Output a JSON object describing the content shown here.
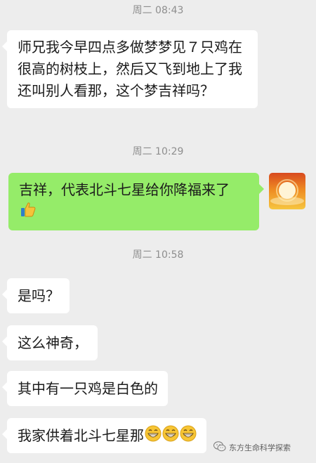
{
  "chat": {
    "messages": [
      {
        "type": "time",
        "text": "周二 08:43"
      },
      {
        "type": "incoming",
        "text": "师兄我今早四点多做梦梦见７只鸡在很高的树枝上，然后又飞到地上了我还叫别人看那，这个梦吉祥吗？"
      },
      {
        "type": "time",
        "text": "周二 10:29"
      },
      {
        "type": "outgoing",
        "text": "吉祥，代表北斗七星给你降福来了",
        "emoji": "thumbs-up-icon"
      },
      {
        "type": "time",
        "text": "周二 10:58"
      },
      {
        "type": "incoming",
        "text": "是吗？"
      },
      {
        "type": "incoming",
        "text": "这么神奇，"
      },
      {
        "type": "incoming",
        "text": "其中有一只鸡是白色的"
      },
      {
        "type": "incoming",
        "text": "我家供着北斗七星那",
        "emoji": [
          "grin-icon",
          "grin-icon",
          "grin-icon"
        ]
      }
    ]
  },
  "watermark": {
    "icon": "wechat-icon",
    "text": "东方生命科学探索"
  },
  "colors": {
    "background": "#ededed",
    "incoming_bubble": "#ffffff",
    "outgoing_bubble": "#95ec69",
    "timestamp": "#8e8e8e"
  }
}
